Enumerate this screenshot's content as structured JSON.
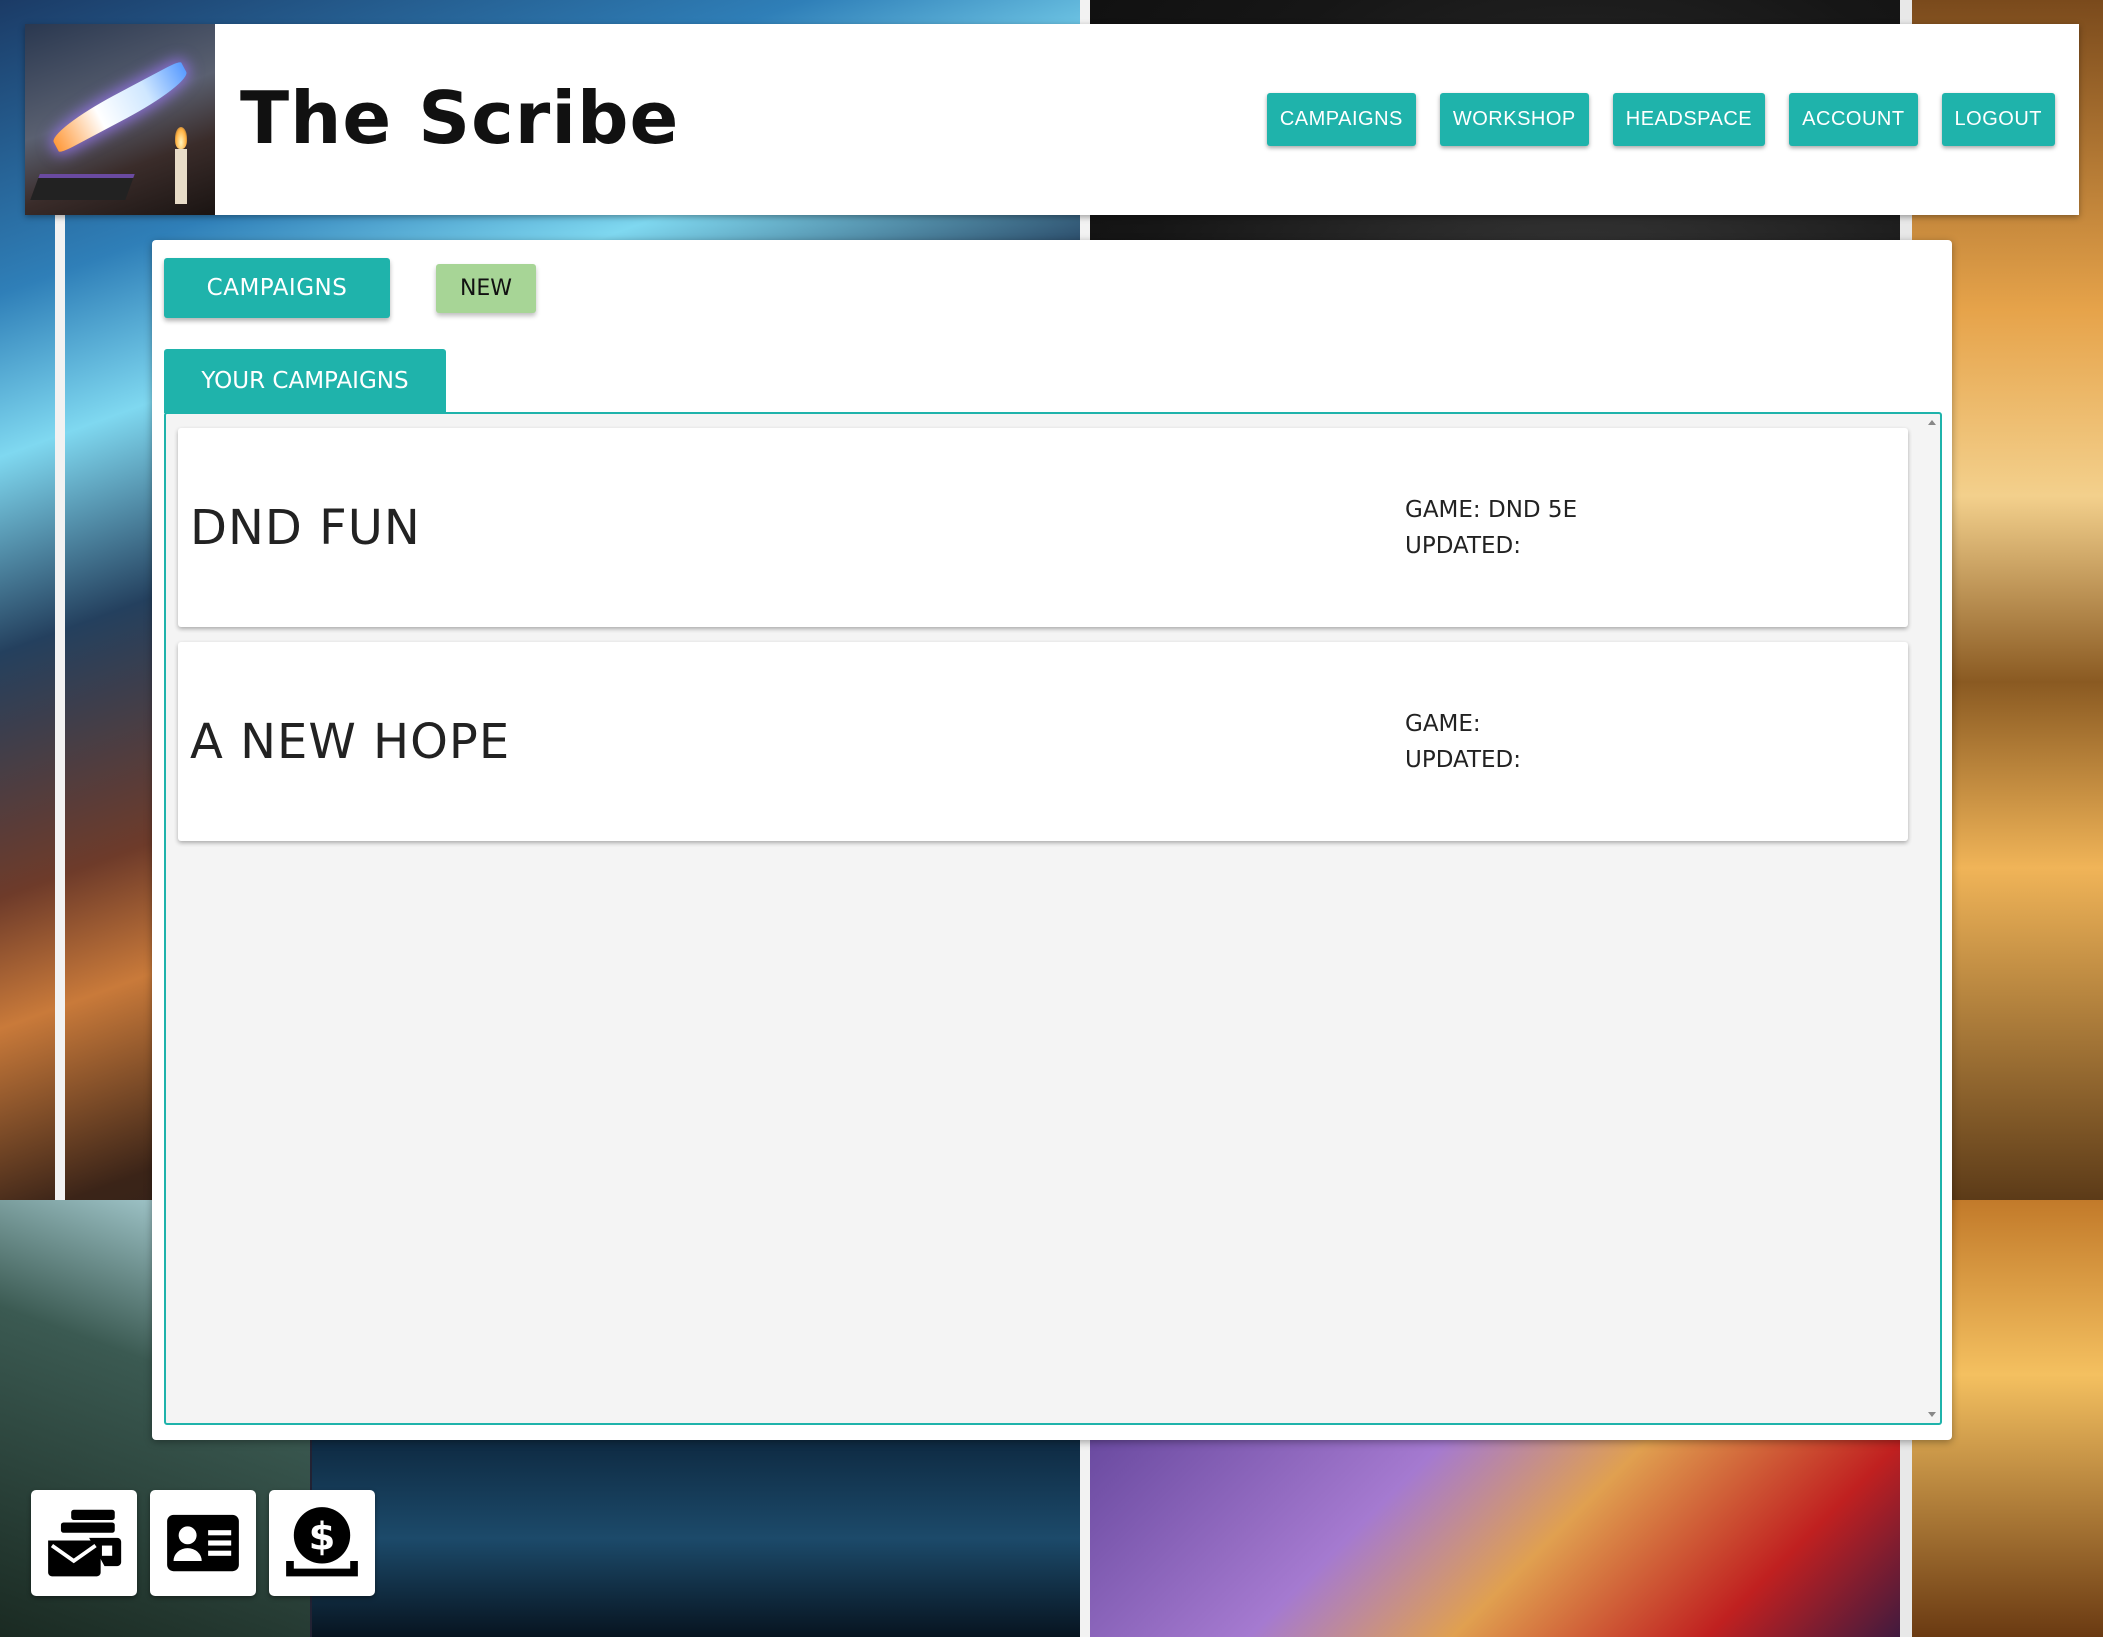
{
  "app": {
    "title": "The Scribe"
  },
  "nav": {
    "items": [
      {
        "label": "CAMPAIGNS"
      },
      {
        "label": "WORKSHOP"
      },
      {
        "label": "HEADSPACE"
      },
      {
        "label": "ACCOUNT"
      },
      {
        "label": "LOGOUT"
      }
    ]
  },
  "toolbar": {
    "campaigns_label": "CAMPAIGNS",
    "new_label": "NEW"
  },
  "section": {
    "title": "YOUR CAMPAIGNS"
  },
  "campaigns": [
    {
      "name": "DND FUN",
      "game": "GAME: DND 5E",
      "updated": "UPDATED:"
    },
    {
      "name": "A NEW HOPE",
      "game": "GAME:",
      "updated": "UPDATED:"
    }
  ],
  "dock": {
    "icons": [
      "inbox-stack-icon",
      "contact-card-icon",
      "money-deposit-icon"
    ]
  },
  "colors": {
    "accent": "#1fb3ab",
    "new_button": "#a7d596",
    "header_bg": "#ffffff",
    "list_bg": "#f4f4f4"
  }
}
